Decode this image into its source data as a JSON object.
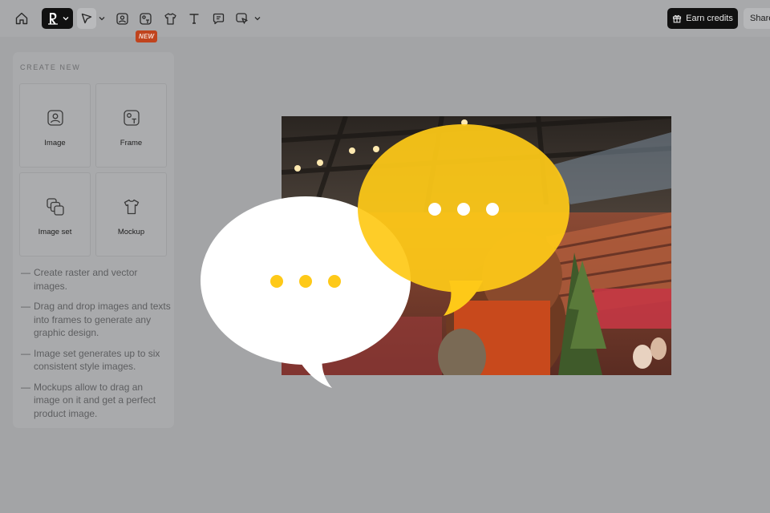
{
  "toolbar": {
    "icons": [
      "home-icon",
      "logo-icon",
      "select-arrow-icon",
      "image-tool-icon",
      "frame-tool-icon",
      "mockup-tool-icon",
      "text-tool-icon",
      "comment-icon",
      "transform-icon"
    ],
    "new_badge": "NEW",
    "earn_credits_label": "Earn credits",
    "share_label": "Share"
  },
  "panel": {
    "heading": "CREATE NEW",
    "cards": [
      {
        "label": "Image",
        "icon": "image-icon"
      },
      {
        "label": "Frame",
        "icon": "frame-icon"
      },
      {
        "label": "Image set",
        "icon": "image-set-icon"
      },
      {
        "label": "Mockup",
        "icon": "tshirt-icon"
      }
    ],
    "tips": [
      "Create raster and vector images.",
      "Drag and drop images and texts into frames to generate any graphic design.",
      "Image set generates up to six consistent style images.",
      "Mockups allow to drag an image on it and get a perfect product image."
    ],
    "tip_dash": "—"
  },
  "colors": {
    "background": "#a3a4a6",
    "bubble_yellow": "#fec918",
    "bubble_white": "#ffffff",
    "badge": "#c0441e"
  }
}
